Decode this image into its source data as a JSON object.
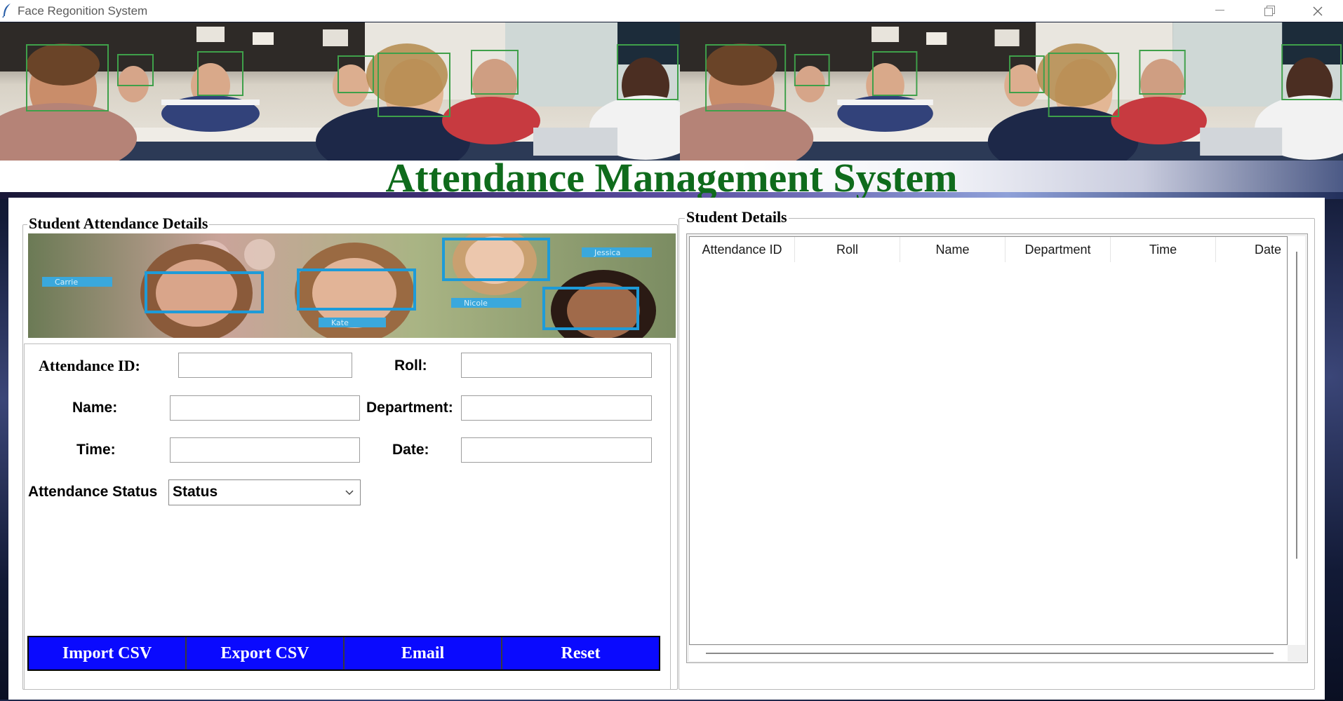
{
  "window": {
    "title": "Face Regonition System"
  },
  "header": {
    "title": "Attendance Management System",
    "title_color": "#0f6b1c"
  },
  "left_panel": {
    "title": "Student Attendance Details",
    "image_tags": [
      "Carrie",
      "Kate",
      "Jessica",
      "Nicole"
    ],
    "form": {
      "attendance_id_label": "Attendance ID:",
      "attendance_id_value": "",
      "roll_label": "Roll:",
      "roll_value": "",
      "name_label": "Name:",
      "name_value": "",
      "department_label": "Department:",
      "department_value": "",
      "time_label": "Time:",
      "time_value": "",
      "date_label": "Date:",
      "date_value": "",
      "status_label": "Attendance Status",
      "status_value": "Status"
    },
    "buttons": {
      "import": "Import CSV",
      "export": "Export CSV",
      "email": "Email",
      "reset": "Reset",
      "color": "#0a0afe"
    }
  },
  "right_panel": {
    "title": "Student Details",
    "columns": [
      "Attendance ID",
      "Roll",
      "Name",
      "Department",
      "Time",
      "Date"
    ],
    "rows": []
  }
}
